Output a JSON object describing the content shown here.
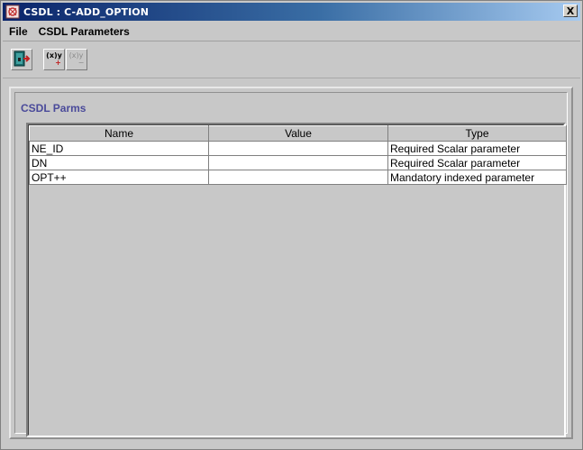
{
  "window": {
    "title": "CSDL : C-ADD_OPTION",
    "close_label": "X"
  },
  "menu": {
    "items": [
      {
        "label": "File"
      },
      {
        "label": "CSDL Parameters"
      }
    ]
  },
  "toolbar": {
    "buttons": [
      {
        "icon": "exit-door-icon",
        "enabled": true
      },
      {
        "icon": "add-parameter-icon",
        "enabled": true,
        "text": "(x)y",
        "sign": "+"
      },
      {
        "icon": "remove-parameter-icon",
        "enabled": false,
        "text": "(x)y",
        "sign": "−"
      }
    ]
  },
  "panel": {
    "title": "CSDL Parms"
  },
  "table": {
    "columns": [
      "Name",
      "Value",
      "Type"
    ],
    "rows": [
      {
        "name": "NE_ID",
        "value": "",
        "type": "Required Scalar parameter"
      },
      {
        "name": "DN",
        "value": "",
        "type": "Required Scalar parameter"
      },
      {
        "name": "OPT++",
        "value": "",
        "type": "Mandatory indexed parameter"
      }
    ]
  },
  "colors": {
    "titlebar_start": "#0a246a",
    "titlebar_end": "#a6caf0",
    "panel_title": "#4a4a9a",
    "background": "#c8c8c8"
  }
}
